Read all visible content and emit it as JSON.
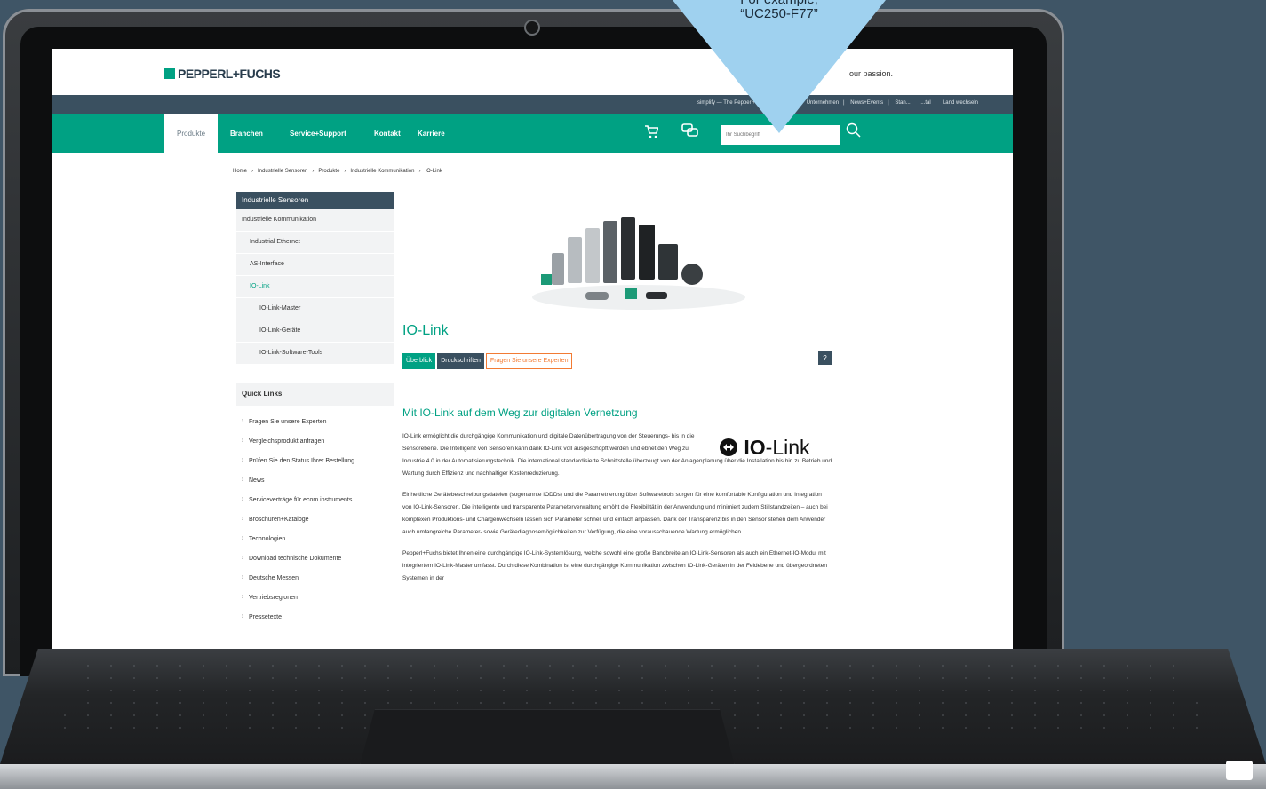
{
  "tooltip": {
    "line1": "For example,",
    "line2": "“UC250-F77”"
  },
  "header": {
    "logo_text": "PEPPERL+FUCHS",
    "tagline": "our passion."
  },
  "topbar": {
    "links": [
      "simplify — The Pepperl+Fuchs Magazine",
      "Unternehmen",
      "News+Events",
      "Stan...",
      "...tal",
      "Land wechseln"
    ]
  },
  "nav": {
    "items": [
      "Produkte",
      "Branchen",
      "Service+Support",
      "Kontakt",
      "Karriere"
    ]
  },
  "search": {
    "placeholder": "Ihr Suchbegriff"
  },
  "breadcrumb": [
    "Home",
    "›",
    "Industrielle Sensoren",
    "›",
    "Produkte",
    "›",
    "Industrielle Kommunikation",
    "›",
    "IO-Link"
  ],
  "sidenav": {
    "header": "Industrielle Sensoren",
    "items": [
      "Industrielle Kommunikation",
      "Industrial Ethernet",
      "AS-Interface",
      "IO-Link",
      "IO-Link-Master",
      "IO-Link-Geräte",
      "IO-Link-Software-Tools"
    ]
  },
  "quicklinks": {
    "header": "Quick Links",
    "items": [
      "Fragen Sie unsere Experten",
      "Vergleichsprodukt anfragen",
      "Prüfen Sie den Status Ihrer Bestellung",
      "News",
      "Serviceverträge für ecom instruments",
      "Broschüren+Kataloge",
      "Technologien",
      "Download technische Dokumente",
      "Deutsche Messen",
      "Vertriebsregionen",
      "Pressetexte"
    ]
  },
  "page": {
    "title": "IO-Link",
    "tabs": [
      "Überblick",
      "Druckschriften",
      "Fragen Sie unsere Experten"
    ],
    "help": "?",
    "subtitle": "Mit IO-Link auf dem Weg zur digitalen Vernetzung",
    "logo_bold": "IO",
    "logo_thin": "-Link",
    "p1": "IO-Link ermöglicht die durchgängige Kommunikation und digitale Datenübertragung von der Steuerungs- bis in die Sensorebene. Die Intelligenz von Sensoren kann dank IO-Link voll ausgeschöpft werden und ebnet den Weg zu",
    "p1b": "Industrie 4.0 in der Automatisierungstechnik. Die international standardisierte Schnittstelle überzeugt von der Anlagenplanung über die Installation bis hin zu Betrieb und Wartung durch Effizienz und nachhaltiger Kostenreduzierung.",
    "p2": "Einheitliche Gerätebeschreibungsdateien (sogenannte IODDs) und die Parametrierung über Softwaretools sorgen für eine komfortable Konfiguration und Integration von IO-Link-Sensoren. Die intelligente und transparente Parameterverwaltung erhöht die Flexibilität in der Anwendung und minimiert zudem Stillstandzeiten – auch bei komplexen Produktions- und Chargenwechseln lassen sich Parameter schnell und einfach anpassen. Dank der Transparenz bis in den Sensor stehen dem Anwender auch umfangreiche Parameter- sowie Gerätediagnosemöglichkeiten zur Verfügung, die eine vorausschauende Wartung ermöglichen.",
    "p3": "Pepperl+Fuchs bietet Ihnen eine durchgängige IO-Link-Systemlösung, welche sowohl eine große Bandbreite an IO-Link-Sensoren als auch ein Ethernet-IO-Modul mit integriertem IO-Link-Master umfasst. Durch diese Kombination ist eine durchgängige Kommunikation zwischen IO-Link-Geräten in der Feldebene und übergeordneten Systemen in der"
  },
  "colors": {
    "brand_green": "#00a183",
    "brand_dark": "#3a5060",
    "accent_orange": "#f27b34",
    "background": "#3f5566",
    "tooltip": "#9fd1ef"
  }
}
